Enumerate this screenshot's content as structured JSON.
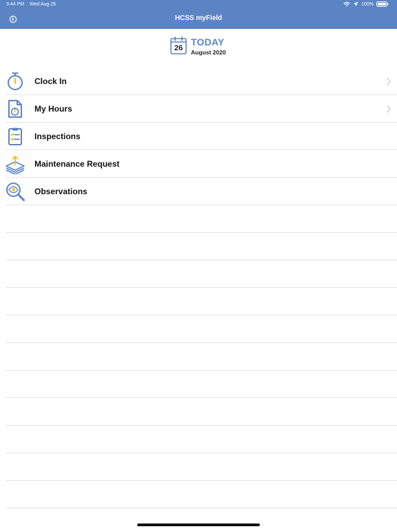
{
  "status_bar": {
    "time": "3:44 PM",
    "date": "Wed Aug 26",
    "battery": "100%"
  },
  "nav": {
    "title": "HCSS myField"
  },
  "today": {
    "day": "26",
    "label": "TODAY",
    "month_year": "August 2020"
  },
  "menu": {
    "items": [
      {
        "label": "Clock In",
        "icon": "stopwatch-icon",
        "has_chevron": true
      },
      {
        "label": "My Hours",
        "icon": "timesheet-icon",
        "has_chevron": true
      },
      {
        "label": "Inspections",
        "icon": "clipboard-checklist-icon",
        "has_chevron": false
      },
      {
        "label": "Maintenance Request",
        "icon": "maintenance-stack-icon",
        "has_chevron": false
      },
      {
        "label": "Observations",
        "icon": "magnifier-eye-icon",
        "has_chevron": false
      }
    ]
  },
  "colors": {
    "accent": "#5b84c4",
    "icon_yellow": "#f2c12e",
    "separator": "#e5e5ea"
  }
}
